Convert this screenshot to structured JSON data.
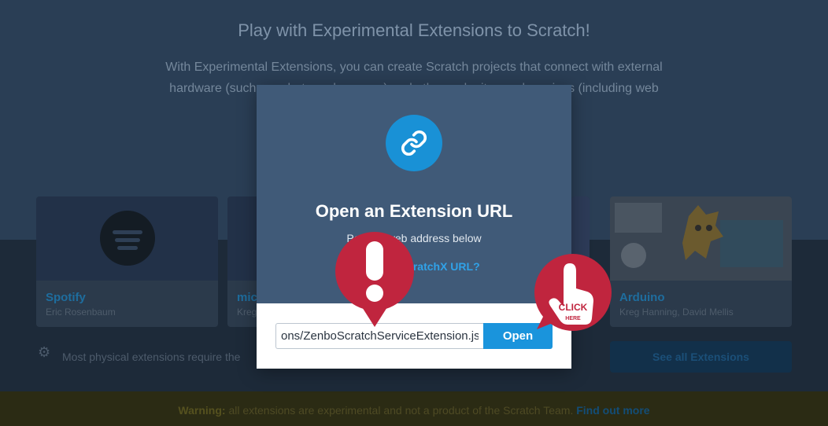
{
  "hero": {
    "title": "Play with Experimental Extensions to Scratch!",
    "description": "With Experimental Extensions, you can create Scratch projects that connect with external hardware (such as robots and sensors) and other web sites and services (including web"
  },
  "cards": [
    {
      "name": "Spotify",
      "author": "Eric Rosenbaum"
    },
    {
      "name": "mic",
      "author": "Kreg"
    },
    {
      "name": "Arduino",
      "author": "Kreg Hanning, David Mellis"
    }
  ],
  "physical_note": "Most physical extensions require the",
  "see_all_label": "See all Extensions",
  "warning": {
    "label": "Warning:",
    "text": "all extensions are experimental and not a product of the Scratch Team.",
    "link": "Find out more"
  },
  "modal": {
    "title": "Open an Extension URL",
    "subtitle": "Paste a web address below",
    "help_link": "ScratchX URL?",
    "url_value": "ons/ZenboScratchServiceExtension.js",
    "open_label": "Open"
  },
  "click_badge": {
    "line1": "CLICK",
    "line2": "HERE"
  },
  "colors": {
    "accent": "#1a94dc",
    "pin_red": "#c0253e",
    "modal_bg": "#405a78"
  }
}
